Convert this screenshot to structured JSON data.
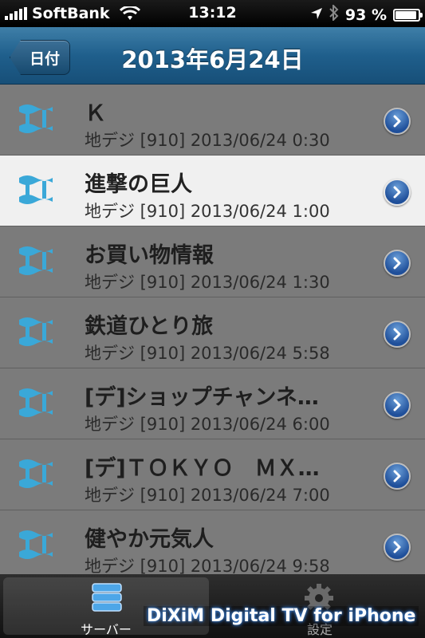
{
  "statusbar": {
    "carrier": "SoftBank",
    "time": "13:12",
    "battery_text": "93 %",
    "battery_level": 0.93
  },
  "navbar": {
    "back_label": "日付",
    "title": "2013年6月24日"
  },
  "programs": [
    {
      "title": "Ｋ",
      "info": "地デジ [910] 2013/06/24 0:30"
    },
    {
      "title": "進撃の巨人",
      "info": "地デジ [910] 2013/06/24 1:00"
    },
    {
      "title": "お買い物情報",
      "info": "地デジ [910] 2013/06/24 1:30"
    },
    {
      "title": "鉄道ひとり旅",
      "info": "地デジ [910] 2013/06/24 5:58"
    },
    {
      "title": "[デ]ショップチャンネ…",
      "info": "地デジ [910] 2013/06/24 6:00"
    },
    {
      "title": "[デ]ＴＯＫＹＯ　ＭＸ…",
      "info": "地デジ [910] 2013/06/24 7:00"
    },
    {
      "title": "健やか元気人",
      "info": "地デジ [910] 2013/06/24 9:58"
    }
  ],
  "tabbar": {
    "server_label": "サーバー",
    "settings_label": "設定"
  },
  "watermark": "DiXiM Digital TV for iPhone",
  "colors": {
    "nav_blue": "#1f5f8c",
    "channel_icon": "#3aa8d8",
    "selected_row": "#f0f0f0"
  }
}
